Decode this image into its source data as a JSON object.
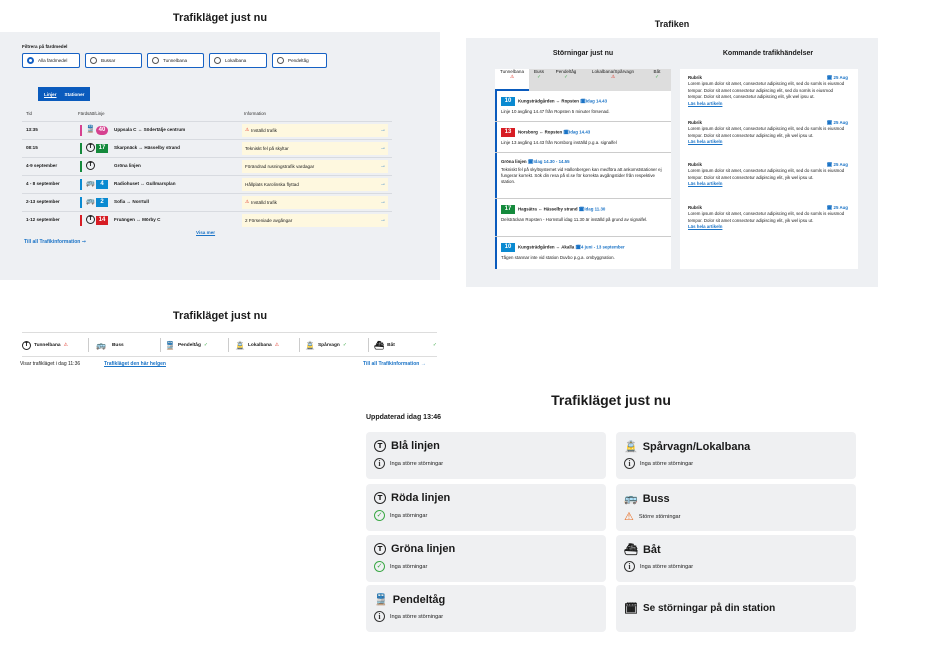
{
  "panel_a": {
    "title": "Trafikläget just nu",
    "filter_label": "Filtrera på färdmedel",
    "filters": [
      "Alla färdmedel",
      "Bussar",
      "Tunnelbana",
      "Lokalbana",
      "Pendeltåg"
    ],
    "tabs": [
      "Linjer",
      "Stationer"
    ],
    "headers": [
      "Tid",
      "Färdsätt/Linje",
      "Information"
    ],
    "rows": [
      {
        "time": "13:35",
        "line": "40",
        "route": "Uppsala C ↔ Södertälje centrum",
        "info": "Inställd trafik",
        "warn": true
      },
      {
        "time": "08:15",
        "line": "17",
        "route": "Skarpnäck ↔ Hässelby strand",
        "info": "Tekniskt fel på skyltar",
        "warn": false
      },
      {
        "time": "4-9 september",
        "line": "",
        "route": "Gröna linjen",
        "info": "Förändrad rusningstrafik vardagar",
        "warn": false
      },
      {
        "time": "4 - 8 september",
        "line": "4",
        "route": "Radiohuset ↔ Gullmarsplan",
        "info": "Hållplats Karolinska flyttad",
        "warn": false
      },
      {
        "time": "2-13 september",
        "line": "2",
        "route": "Sofia ↔ Norrtull",
        "info": "Inställd trafik",
        "warn": true
      },
      {
        "time": "1-12 september",
        "line": "14",
        "route": "Fruängen ↔ Mörby C",
        "info": "2 Förseniade avgångar",
        "warn": false
      }
    ],
    "show_more": "Visa mer",
    "all_link": "Till all Trafikinformation"
  },
  "panel_b": {
    "title": "Trafiken",
    "col1_title": "Störningar just nu",
    "col2_title": "Kommande trafikhändelser",
    "tabs": [
      "Tunnelbana",
      "Buss",
      "Pendeltåg",
      "Lokalbana/Spårvagn",
      "Båt"
    ],
    "cards": [
      {
        "line": "10",
        "route": "Kungsträdgården ↔ Ropsten",
        "date": "Idag 14.43",
        "text": "Linje 10 avgång 14.47 från Ropsten 5 minuter försenad."
      },
      {
        "line": "13",
        "route": "Norsborg ↔ Ropsten",
        "date": "Idag 14.43",
        "text": "Linje 13 avgång 14.43 från Norsborg inställd p.g.a. signalfel"
      },
      {
        "line": "",
        "route": "Gröna linjen",
        "date": "Idag 14.30 - 14.55",
        "text": "Tekniskt fel på skyltsystemet vid Hallonbergen kan medföra att ankomststationer ej fungerar korrekt. Sök din resa på sl.se för korrekta avgångstider från respektive station."
      },
      {
        "line": "17",
        "route": "Hagsätra ↔ Hässelby strand",
        "date": "Idag 11.30",
        "text": "Delsträckan Ropsten - Hornstull idag 11.30 är inställd på grund av signalfel."
      },
      {
        "line": "10",
        "route": "Kungsträdgården ↔ Akalla",
        "date": "4 juni - 13 september",
        "text": "Tågen stannar inte vid station Duvbo p.g.a. ombyggnation."
      }
    ],
    "articles": [
      {
        "title": "Rubrik",
        "date": "25 Aug",
        "text": "Lorem ipsum dolor sit amet, consectetur adipiscing elit, sed do somls is eiusmod tempor. Dolor sit amet consectetur adipiscing elit, sed do somls is eiusmod tempor. Dolor sit amet, consectetur adipiscing elit, yik wel ipsu ut.",
        "link": "Läs hela artikeln"
      },
      {
        "title": "Rubrik",
        "date": "25 Aug",
        "text": "Lorem ipsum dolor sit amet, consectetur adipiscing elit, sed do somls is eiusmod tempor. Dolor sit amet consectetur adipiscing elit, yik wel ipsu ut.",
        "link": "Läs hela artikeln"
      },
      {
        "title": "Rubrik",
        "date": "25 Aug",
        "text": "Lorem ipsum dolor sit amet, consectetur adipiscing elit, sed do somls is eiusmod tempor. Dolor sit amet consectetur adipiscing elit, yik wel ipsu ut.",
        "link": "Läs hela artikeln"
      },
      {
        "title": "Rubrik",
        "date": "25 Aug",
        "text": "Lorem ipsum dolor sit amet, consectetur adipiscing elit, sed do somls is eiusmod tempor. Dolor sit amet consectetur adipiscing elit, yik wel ipsu ut.",
        "link": "Läs hela artikeln"
      }
    ]
  },
  "panel_c": {
    "title": "Trafikläget just nu",
    "modes": [
      "Tunnelbana",
      "Buss",
      "Pendeltåg",
      "Lokalbana",
      "Spårvagn",
      "Båt"
    ],
    "status_text": "Visar trafikläget i dag 11:36",
    "weekend_link": "Trafikläget den här helgen",
    "all_link": "Till all Trafikinformation"
  },
  "panel_d": {
    "title": "Trafikläget just nu",
    "updated": "Uppdaterad idag 13:46",
    "tiles": [
      {
        "title": "Blå linjen",
        "status": "Inga större störningar"
      },
      {
        "title": "Spårvagn/Lokalbana",
        "status": "Inga större störningar"
      },
      {
        "title": "Röda linjen",
        "status": "Inga störningar"
      },
      {
        "title": "Buss",
        "status": "Större störningar"
      },
      {
        "title": "Gröna linjen",
        "status": "Inga störningar"
      },
      {
        "title": "Båt",
        "status": "Inga större störningar"
      },
      {
        "title": "Pendeltåg",
        "status": "Inga större störningar"
      },
      {
        "title": "Se störningar på din station",
        "status": ""
      }
    ]
  },
  "colors": {
    "accent": "#0a5bbd",
    "red": "#d71d24",
    "green": "#148a3c",
    "blue": "#0a8ad1",
    "pink": "#d64190",
    "warning": "#fef8df"
  }
}
